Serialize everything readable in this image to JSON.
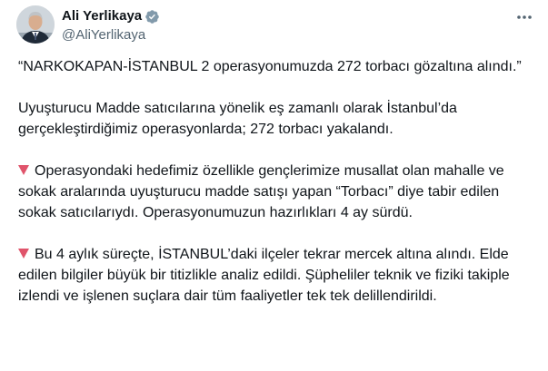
{
  "author": {
    "display_name": "Ali Yerlikaya",
    "handle": "@AliYerlikaya",
    "verified_color": "#829aab"
  },
  "icons": {
    "verified": "verified-badge-icon",
    "more": "more-options-icon",
    "bullet": "red-down-triangle-icon"
  },
  "tweet": {
    "paragraph_1": "“NARKOKAPAN-İSTANBUL 2 operasyonumuzda 272 torbacı gözaltına alındı.”",
    "paragraph_2": "Uyuşturucu Madde satıcılarına yönelik eş zamanlı olarak İstanbul’da gerçekleştirdiğimiz operasyonlarda; 272 torbacı yakalandı.",
    "paragraph_3": "Operasyondaki hedefimiz özellikle gençlerimize musallat olan mahalle ve sokak aralarında uyuşturucu madde satışı yapan “Torbacı” diye tabir edilen sokak satıcılarıydı. Operasyonumuzun hazırlıkları 4 ay sürdü.",
    "paragraph_4": "Bu 4 aylık süreçte, İSTANBUL’daki ilçeler tekrar mercek altına alındı. Elde edilen bilgiler büyük bir titizlikle analiz edildi. Şüpheliler teknik ve fiziki takiple izlendi ve işlenen suçlara dair tüm faaliyetler tek tek delillendirildi."
  },
  "colors": {
    "text": "#0f1419",
    "secondary": "#536471",
    "bullet": "#e0546b"
  }
}
